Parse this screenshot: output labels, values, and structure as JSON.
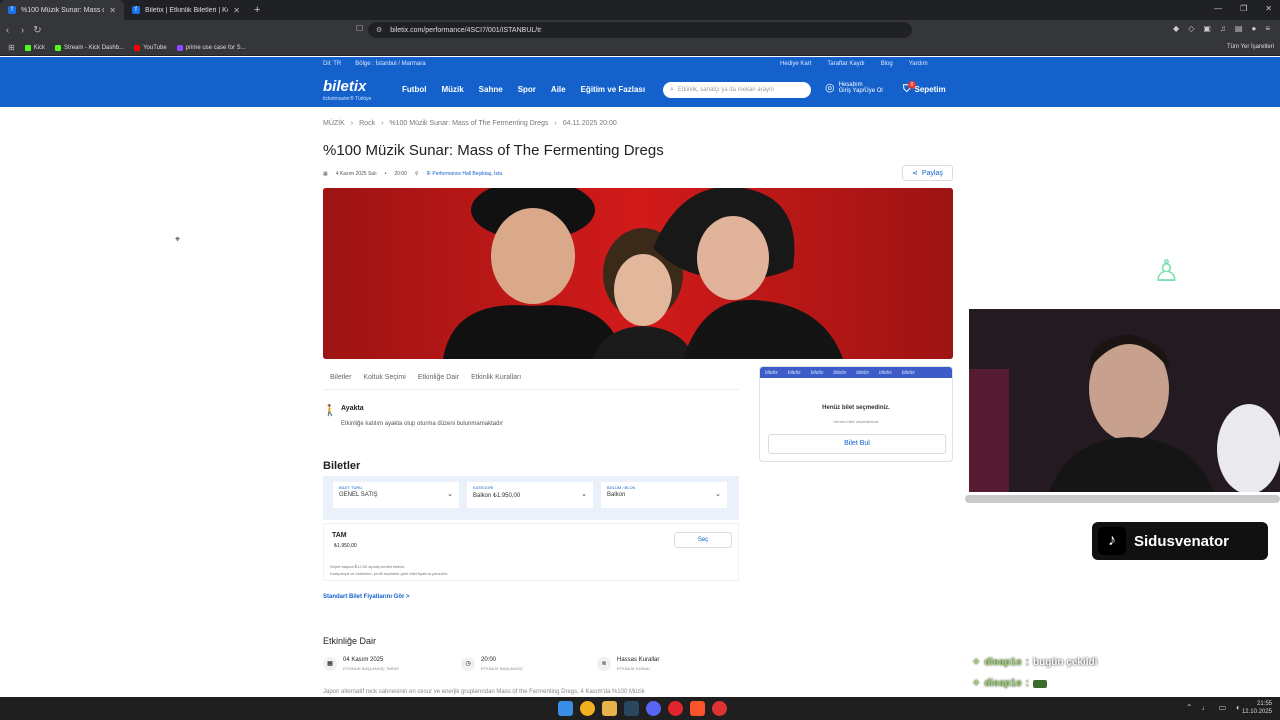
{
  "browser": {
    "tabs": [
      {
        "title": "%100 Müzik Sunar: Mass of The",
        "active": true
      },
      {
        "title": "Biletix | Etkinlik Biletleri | Konser, Spo",
        "active": false
      }
    ],
    "url": "biletix.com/performance/4SCI7/001/ISTANBUL/tr",
    "bookmarks": [
      "Kick",
      "Stream - Kick Dashb...",
      "YouTube",
      "prime use case for S..."
    ],
    "all_bookmarks": "Tüm Yer İşaretleri"
  },
  "site": {
    "top_left": [
      "Dil: TR",
      "Bölge : İstanbul / Marmara"
    ],
    "top_right": [
      "Hediye Kart",
      "Taraftar Kaydı",
      "Blog",
      "Yardım"
    ],
    "logo": "biletix",
    "logo_sub": "ticketmaster® Türkiye",
    "menu": [
      "Futbol",
      "Müzik",
      "Sahne",
      "Spor",
      "Aile",
      "Eğitim ve Fazlası"
    ],
    "search_placeholder": "Etkinlik, sanatçı ya da mekan arayın",
    "account_line1": "Hesabım",
    "account_line2": "Giriş Yap/Üye Ol",
    "cart": "Sepetim",
    "cart_count": "0"
  },
  "event": {
    "breadcrumbs": [
      "MÜZİK",
      "Rock",
      "%100 Müzik Sunar: Mass of The Fermenting Dregs",
      "04.11.2025 20:00"
    ],
    "title": "%100 Müzik Sunar: Mass of The Fermenting Dregs",
    "date": "4 Kasım 2025 Salı",
    "time": "20:00",
    "venue": "IF Performance Hall Beşiktaş, İsta",
    "share": "Paylaş",
    "tabs": [
      "Biletler",
      "Koltuk Seçimi",
      "Etkinliğe Dair",
      "Etkinlik Kuralları"
    ],
    "ayakta_title": "Ayakta",
    "ayakta_desc": "Etkinliğe katılım ayakta olup oturma düzeni bulunmamaktadır",
    "biletler_title": "Biletler",
    "filters": [
      {
        "label": "BİLET TÜRÜ",
        "value": "GENEL SATIŞ"
      },
      {
        "label": "KATEGORİ",
        "value": "Balkon ₺1.950,00"
      },
      {
        "label": "BÖLÜM / BLOK",
        "value": "Balkon"
      }
    ],
    "ticket_name": "TAM",
    "ticket_price": "₺1.950,00",
    "select_label": "Seç",
    "note1": "Sepet başına ₺12,50 sipariş bedeli eklenir.",
    "note2": "Kampanya ve indirimler, profil seçimine göre bilet fiyatına yansıtılır.",
    "std_link": "Standart Bilet Fiyatlarını Gör >",
    "dair_title": "Etkinliğe Dair",
    "info": [
      {
        "value": "04 Kasım 2025",
        "sub": "ETKİNLİK BAŞLANGIÇ TARİHİ"
      },
      {
        "value": "20:00",
        "sub": "ETKİNLİK BAŞLANGIÇ"
      },
      {
        "value": "Hassas Kurallar",
        "sub": "ETKİNLİK KURALI"
      }
    ],
    "para": "Japon alternatif rock sahnesinin en cesur ve enerjik gruplarından Mass of the Fermenting Dregs, 4 Kasım'da %100 Müzik"
  },
  "sidecard": {
    "stripe_text": "biletix",
    "empty": "Henüz bilet seçmediniz.",
    "sub": "Hemen bilet seçebilirsiniz",
    "find": "Bilet Bul"
  },
  "stream": {
    "handle": "Sidusvenator",
    "chat": [
      {
        "user": "dieap1e",
        "msg": "bugün çekildi"
      },
      {
        "user": "dieap1e",
        "msg": ""
      }
    ]
  },
  "clock": {
    "time": "21:55",
    "date": "12.10.2025"
  }
}
